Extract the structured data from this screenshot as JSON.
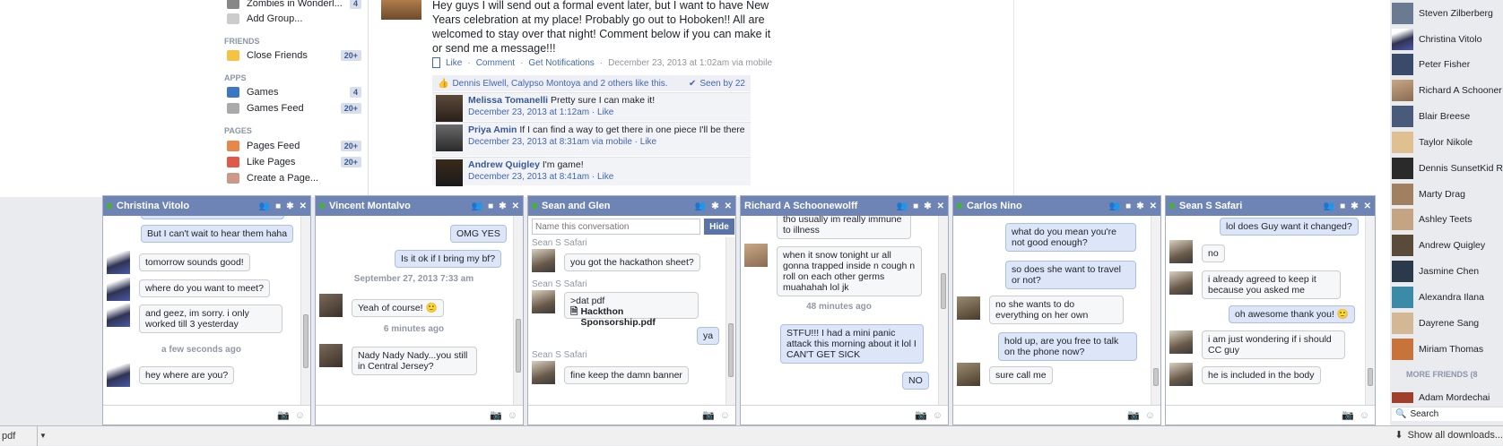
{
  "left_nav": {
    "group_item": {
      "label": "Zombies in Wonderl...",
      "count": "4"
    },
    "add_group": "Add Group...",
    "friends_header": "FRIENDS",
    "close_friends": {
      "label": "Close Friends",
      "count": "20+"
    },
    "apps_header": "APPS",
    "games": {
      "label": "Games",
      "count": "4"
    },
    "games_feed": {
      "label": "Games Feed",
      "count": "20+"
    },
    "pages_header": "PAGES",
    "pages_feed": {
      "label": "Pages Feed",
      "count": "20+"
    },
    "like_pages": {
      "label": "Like Pages",
      "count": "20+"
    },
    "create_page": "Create a Page..."
  },
  "post": {
    "text": "Hey guys I will send out a formal event later, but I want to have New Years celebration at my place! Probably go out to Hoboken!! All are welcomed to stay over that night! Comment below if you can make it or send me a message!!!",
    "like": "Like",
    "comment": "Comment",
    "notifications": "Get Notifications",
    "meta": "December 23, 2013 at 1:02am via mobile",
    "likers": "Dennis Elwell, Calypso Montoya and 2 others like this.",
    "seen_by": "Seen by 22",
    "comments": [
      {
        "name": "Melissa Tomanelli",
        "text": "Pretty sure I can make it!",
        "meta": "December 23, 2013 at 1:12am · Like"
      },
      {
        "name": "Priya Amin",
        "text": "If I can find a way to get there in one piece I'll be there",
        "meta": "December 23, 2013 at 8:31am via mobile · Like"
      },
      {
        "name": "Andrew Quigley",
        "text": "I'm game!",
        "meta": "December 23, 2013 at 8:41am · Like"
      }
    ]
  },
  "friends": [
    "Steven Zilberberg",
    "Christina Vitolo",
    "Peter Fisher",
    "Richard A Schooner",
    "Blair Breese",
    "Taylor Nikole",
    "Dennis SunsetKid R...",
    "Marty Drag",
    "Ashley Teets",
    "Andrew Quigley",
    "Jasmine Chen",
    "Alexandra Ilana",
    "Dayrene Sang",
    "Miriam Thomas"
  ],
  "more_friends": "MORE FRIENDS (8",
  "friend_after_more": "Adam Mordechai",
  "sidebar_search": "Search",
  "chats": {
    "christina": {
      "title": "Christina Vitolo",
      "msgs": [
        "But I can't wait to hear them haha",
        "tomorrow sounds good!",
        "where do you want to meet?",
        "and geez, im sorry. i only worked till 3 yesterday",
        "a few seconds ago",
        "hey where are you?"
      ]
    },
    "vincent": {
      "title": "Vincent Montalvo",
      "msgs": [
        "OMG YES",
        "Is it ok if I bring my bf?",
        "September 27, 2013 7:33 am",
        "Yeah of course! 🙂",
        "6 minutes ago",
        "Nady Nady Nady...you still in Central Jersey?"
      ]
    },
    "sean_glen": {
      "title": "Sean and Glen",
      "name_placeholder": "Name this conversation",
      "hide": "Hide",
      "sender": "Sean S Safari",
      "msgs": [
        "you got the hackathon sheet?",
        ">dat pdf",
        "Hackthon Sponsorship.pdf",
        "ya",
        "fine keep the damn banner"
      ]
    },
    "richard": {
      "title": "Richard A Schoonewolff",
      "msgs": [
        "tho usually im really immune to illness",
        "when it snow tonight ur all gonna trapped inside n cough n roll on each other germs muahahah lol jk",
        "48 minutes ago",
        "STFU!!! I had a mini panic attack this morning about it lol I CAN'T GET SICK",
        "NO"
      ]
    },
    "carlos": {
      "title": "Carlos Nino",
      "msgs": [
        "what do you mean you're not good enough?",
        "so does she want to travel or not?",
        "no she wants to do everything on her own",
        "hold up, are you free to talk on the phone now?",
        "sure call me"
      ]
    },
    "sean": {
      "title": "Sean S Safari",
      "msgs": [
        "lol does Guy want it changed?",
        "no",
        "i already agreed to keep it because you asked me",
        "oh awesome thank you! 🙂",
        "i am just wondering if i should CC guy",
        "he is included in the body"
      ]
    }
  },
  "download_bar": {
    "file": "pdf",
    "show_all": "Show all downloads..."
  }
}
